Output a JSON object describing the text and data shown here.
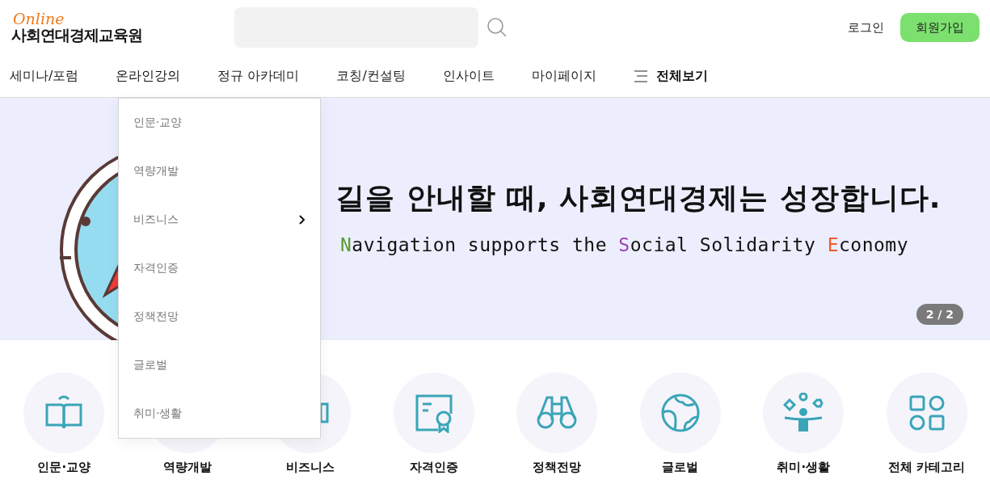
{
  "logo": {
    "script": "Online",
    "name": "사회연대경제교육원"
  },
  "account": {
    "login": "로그인",
    "signup": "회원가입"
  },
  "nav": [
    {
      "label": "세미나/포럼",
      "expanded": false
    },
    {
      "label": "온라인강의",
      "expanded": true,
      "submenu": [
        {
          "label": "인문·교양",
          "has_submenu": false
        },
        {
          "label": "역량개발",
          "has_submenu": false
        },
        {
          "label": "비즈니스",
          "has_submenu": true
        },
        {
          "label": "자격인증",
          "has_submenu": false
        },
        {
          "label": "정책전망",
          "has_submenu": false
        },
        {
          "label": "글로벌",
          "has_submenu": false
        },
        {
          "label": "취미·생활",
          "has_submenu": false
        }
      ]
    },
    {
      "label": "정규 아카데미",
      "expanded": false
    },
    {
      "label": "코칭/컨설팅",
      "expanded": false
    },
    {
      "label": "인사이트",
      "expanded": false
    },
    {
      "label": "마이페이지",
      "expanded": false
    }
  ],
  "all_menu": {
    "label": "전체보기"
  },
  "banner": {
    "headline": "길을 안내할 때, 사회연대경제는 성장합니다.",
    "subtitle": [
      {
        "text": "N",
        "color": "#5a9a32"
      },
      {
        "text": "avigation supports the ",
        "color": "#111111"
      },
      {
        "text": "S",
        "color": "#9b3fb5"
      },
      {
        "text": "ocial Solidarity ",
        "color": "#111111"
      },
      {
        "text": "E",
        "color": "#f15a2b"
      },
      {
        "text": "conomy",
        "color": "#111111"
      }
    ],
    "counter": "2 / 2"
  },
  "categories": [
    {
      "label": "인문·교양"
    },
    {
      "label": "역량개발"
    },
    {
      "label": "비즈니스"
    },
    {
      "label": "자격인증"
    },
    {
      "label": "정책전망"
    },
    {
      "label": "글로벌"
    },
    {
      "label": "취미·생활"
    },
    {
      "label": "전체 카테고리"
    }
  ]
}
